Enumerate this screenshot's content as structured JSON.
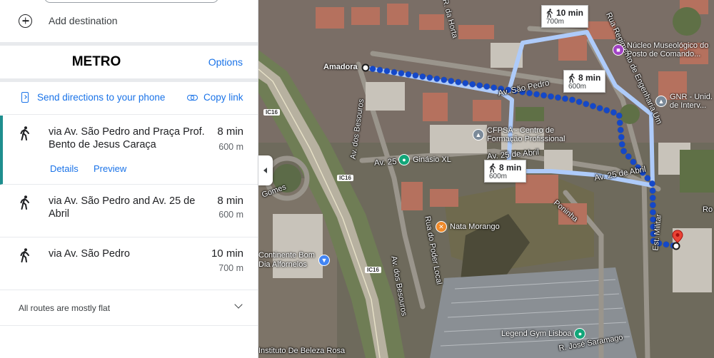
{
  "panel": {
    "add_destination": "Add destination",
    "mode_title": "METRO",
    "options": "Options",
    "send_directions": "Send directions to your phone",
    "copy_link": "Copy link",
    "routes": [
      {
        "name": "via Av. São Pedro and Praça Prof. Bento de Jesus Caraça",
        "time": "8 min",
        "distance": "600 m",
        "selected": true
      },
      {
        "name": "via Av. São Pedro and Av. 25 de Abril",
        "time": "8 min",
        "distance": "600 m",
        "selected": false
      },
      {
        "name": "via Av. São Pedro",
        "time": "10 min",
        "distance": "700 m",
        "selected": false
      }
    ],
    "details": "Details",
    "preview": "Preview",
    "flat_note": "All routes are mostly flat"
  },
  "map": {
    "origin": "Amadora",
    "bubbles": [
      {
        "time": "10 min",
        "distance": "700m"
      },
      {
        "time": "8 min",
        "distance": "600m"
      },
      {
        "time": "8 min",
        "distance": "600m"
      }
    ],
    "streets": {
      "sao_pedro": "Av. São Pedro",
      "abril_25_a": "Av. 25 de Abril",
      "abril_25_b": "Av. 25 de Abril",
      "abril_25_c": "Av. 25",
      "besouros_a": "Av. dos Besouros",
      "besouros_b": "Av. dos Besouros",
      "regimento": "Rua Regimento de Engenharia Um",
      "estr_militar": "Est. Militar",
      "ponte": "Rua do Poder Local",
      "horta": "R. da Horta",
      "poninha": "Poninha",
      "gomes": "Gomes",
      "jose_saramago": "R. José Saramago"
    },
    "roads": {
      "ic16_a": "IC16",
      "ic16_b": "IC16",
      "ic16_c": "IC16"
    },
    "pois": {
      "museum": "Núcleo Museológico do Posto de Comando...",
      "gnr": "GNR - Unid. de Interv...",
      "cfpsa": "CFPSA - Centro de Formação Profissional",
      "ginasio": "Ginásio XL",
      "nata": "Nata Morango",
      "continente": "Continente Bom Dia Alfornelos",
      "legend_gym": "Legend Gym Lisboa",
      "beleza": "Instituto De Beleza Rosa",
      "ro": "Ro"
    }
  }
}
